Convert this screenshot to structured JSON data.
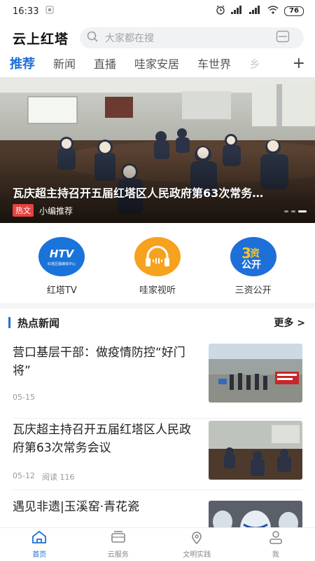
{
  "status_bar": {
    "time": "16:33",
    "battery": "76"
  },
  "header": {
    "brand": "云上红塔",
    "search_placeholder": "大家都在搜"
  },
  "tabs": [
    {
      "label": "推荐",
      "active": true
    },
    {
      "label": "新闻"
    },
    {
      "label": "直播"
    },
    {
      "label": "哇家安居"
    },
    {
      "label": "车世界"
    },
    {
      "label": "乡"
    }
  ],
  "banner": {
    "title": "瓦庆超主持召开五届红塔区人民政府第63次常务…",
    "tag": "热文",
    "source": "小编推荐"
  },
  "shortcuts": [
    {
      "label": "红塔TV",
      "icon": "htv-logo-icon",
      "logo_text": "HTV",
      "logo_sub": "红塔区融媒体中心",
      "color": "#1a73d9"
    },
    {
      "label": "哇家视听",
      "icon": "headphones-icon",
      "color": "#f6a21e"
    },
    {
      "label": "三资公开",
      "icon": "sanzi-logo-icon",
      "logo_text": "资",
      "logo_sub": "公开",
      "color": "#1e6fd8"
    }
  ],
  "hot_news": {
    "title": "热点新闻",
    "more": "更多 >",
    "items": [
      {
        "title": "营口基层干部：做疫情防控“好门将”",
        "date": "05-15",
        "reads": ""
      },
      {
        "title": "瓦庆超主持召开五届红塔区人民政府第63次常务会议",
        "date": "05-12",
        "reads": "阅读 116"
      },
      {
        "title": "遇见非遗|玉溪窑·青花瓷",
        "date": "",
        "reads": ""
      }
    ]
  },
  "bottom_nav": [
    {
      "label": "首页",
      "icon": "home-icon",
      "active": true
    },
    {
      "label": "云服务",
      "icon": "cloud-service-icon"
    },
    {
      "label": "文明实践",
      "icon": "location-pin-icon"
    },
    {
      "label": "我",
      "icon": "user-icon"
    }
  ],
  "colors": {
    "accent": "#1e6fd8",
    "hot_tag": "#e64340"
  }
}
